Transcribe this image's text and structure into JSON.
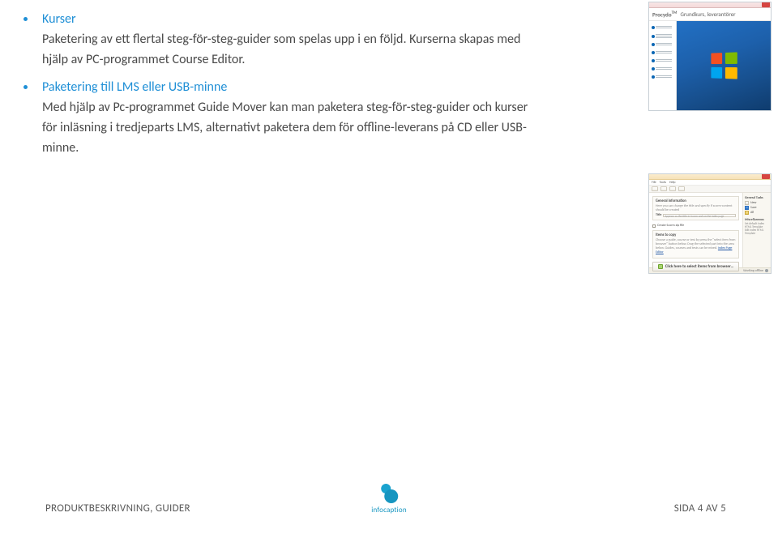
{
  "bullets": [
    {
      "heading": "Kurser",
      "body": "Paketering av ett flertal steg-för-steg-guider som spelas upp i en följd. Kurserna skapas med hjälp av PC-programmet Course Editor."
    },
    {
      "heading": "Paketering till LMS eller USB-minne",
      "body": "Med hjälp av Pc-programmet Guide Mover kan man paketera steg-för-steg-guider och kurser för inläsning i tredjeparts LMS, alternativt paketera dem för offline-leverans på CD eller USB-minne."
    }
  ],
  "thumb1": {
    "brand": "Procydo",
    "brand_tm": "TM",
    "course_title": "Grundkurs, leverantörer"
  },
  "thumb2": {
    "menu": {
      "file": "File",
      "tools": "Tools",
      "help": "Help"
    },
    "panels": {
      "general_title": "General information",
      "general_sub1": "Here you can change the title and specify if scorm-content should be created",
      "title_label": "Title",
      "title_hint": "Appears as the title in Scorm and on the index page",
      "create_scorm": "Create Scorm zip file",
      "items_title": "Items to copy",
      "items_body": "Choose a guide, course or test by press the \"select item from browser\" button below. Drag the selected part into the area below. Guides, courses and tests can be mixed.",
      "index_editor_link": "Index Page Editor",
      "select_btn": "Click here to select items from browser…"
    },
    "side": {
      "general_hdr": "General Tasks",
      "new": "New",
      "save": "Save",
      "all": "All",
      "misc_hdr": "Miscellaneous",
      "misc1": "Set default Index HTML Template",
      "misc2": "Edit Index HTML Template"
    },
    "status": "Working offline"
  },
  "footer": {
    "left": "PRODUKTBESKRIVNING, GUIDER",
    "brand": "infocaption",
    "right": "SIDA 4 AV 5"
  }
}
